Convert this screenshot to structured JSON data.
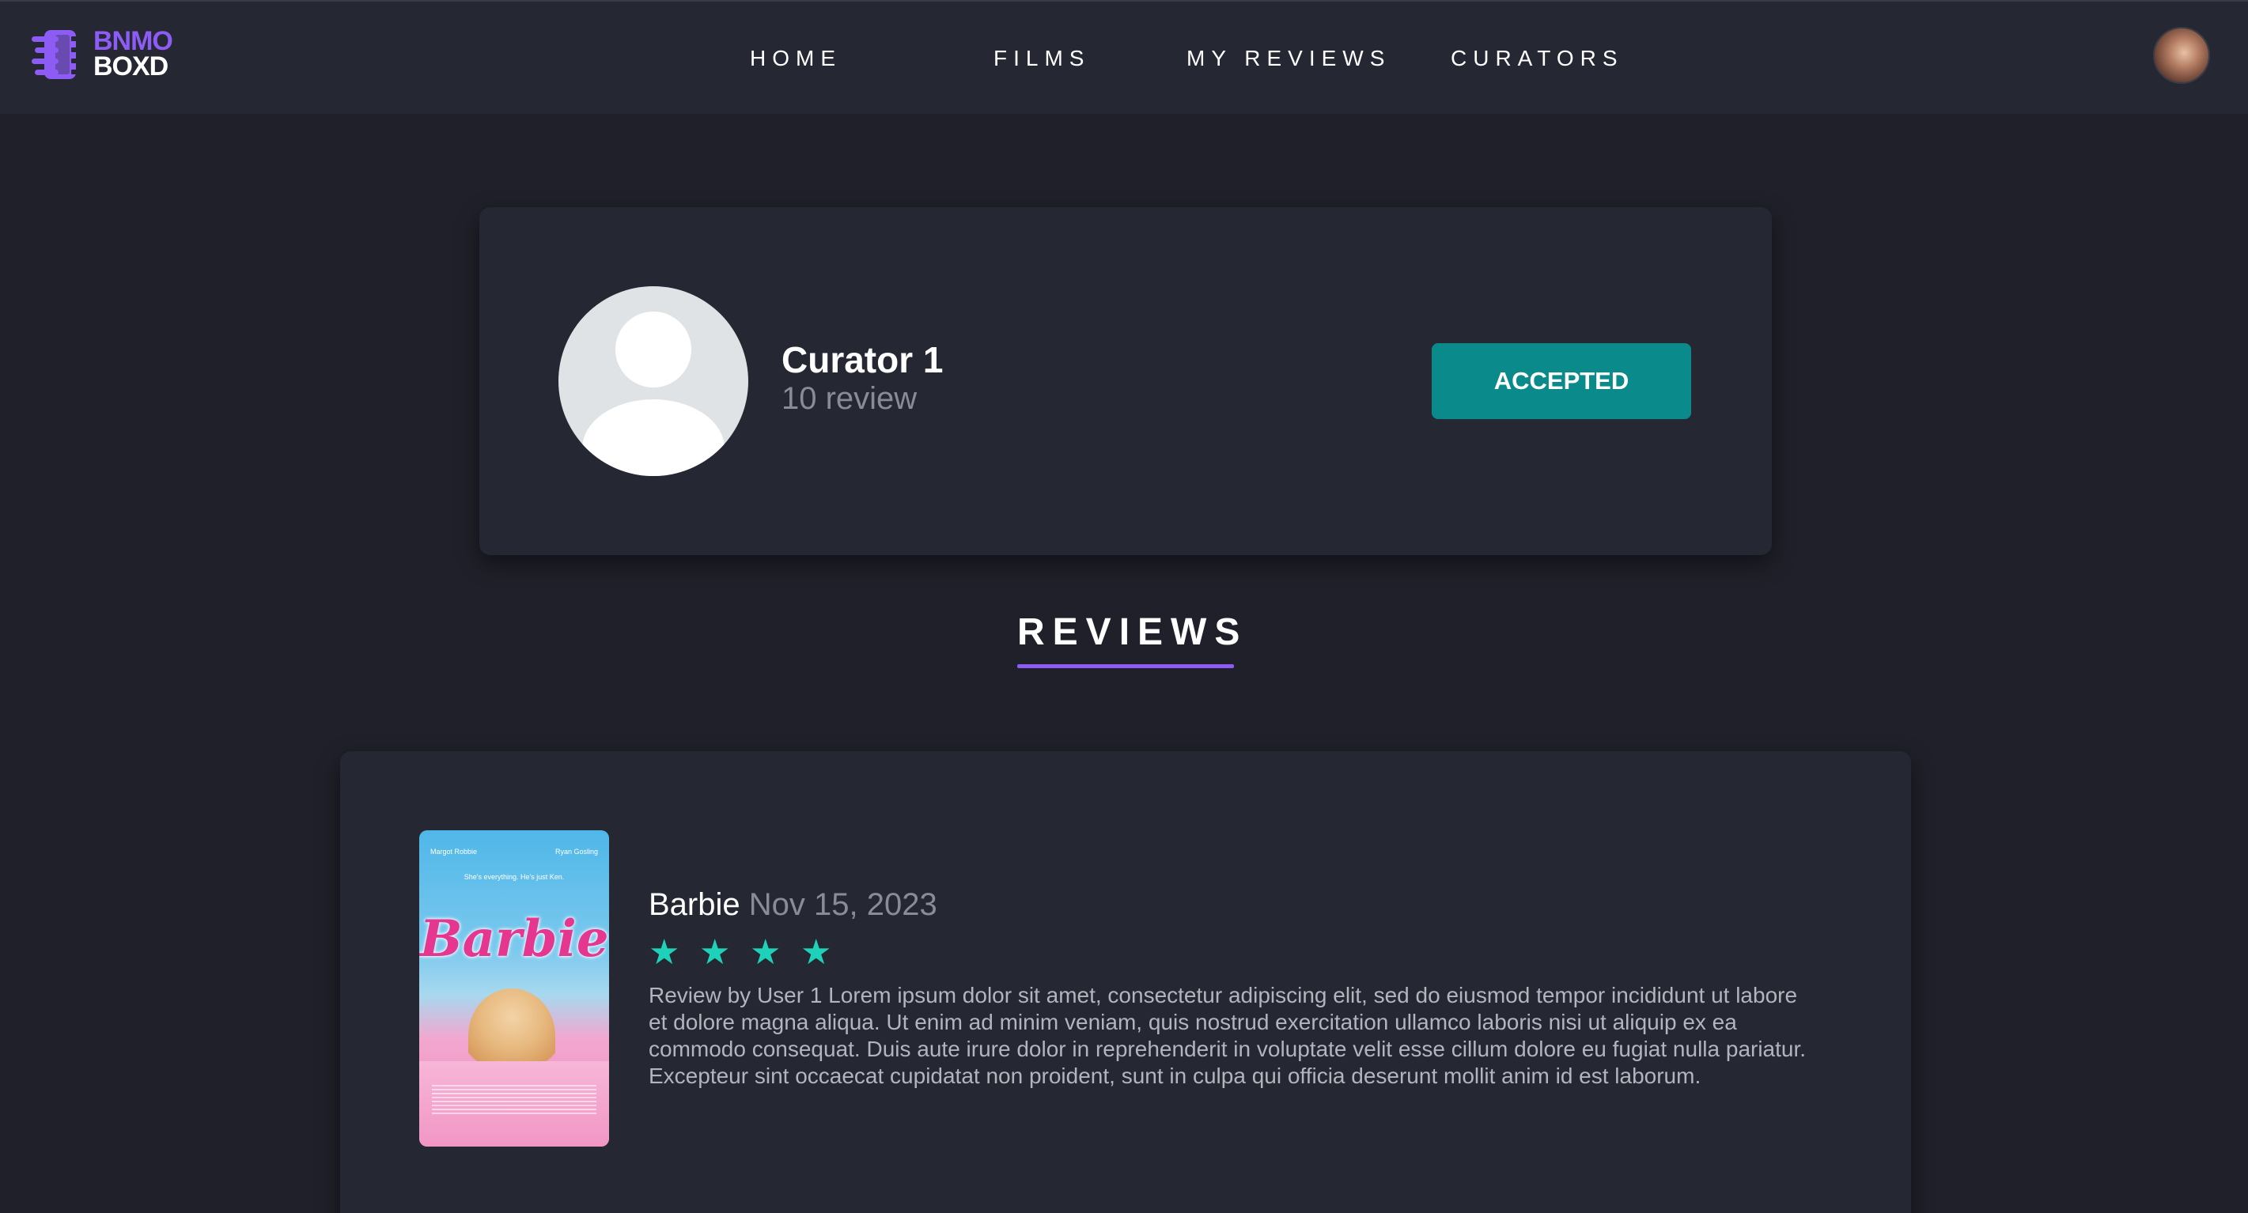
{
  "navbar": {
    "logo": {
      "line1": "BNMO",
      "line2": "BOXD"
    },
    "links": [
      {
        "label": "HOME"
      },
      {
        "label": "FILMS"
      },
      {
        "label": "MY REVIEWS"
      },
      {
        "label": "CURATORS"
      }
    ],
    "avatar_icon": "user-avatar"
  },
  "curator": {
    "name": "Curator 1",
    "review_count": "10 review",
    "status_label": "ACCEPTED",
    "profile_icon": "default-user-icon"
  },
  "reviews_section": {
    "title": "REVIEWS"
  },
  "reviews": [
    {
      "film": "Barbie",
      "date": "Nov 15, 2023",
      "rating": 4,
      "body": "Review by User 1 Lorem ipsum dolor sit amet, consectetur adipiscing elit, sed do eiusmod tempor incididunt ut labore et dolore magna aliqua. Ut enim ad minim veniam, quis nostrud exercitation ullamco laboris nisi ut aliquip ex ea commodo consequat. Duis aute irure dolor in reprehenderit in voluptate velit esse cillum dolore eu fugiat nulla pariatur. Excepteur sint occaecat cupidatat non proident, sunt in culpa qui officia deserunt mollit anim id est laborum.",
      "poster": {
        "title": "Barbie",
        "credit_left": "Margot Robbie",
        "credit_right": "Ryan Gosling",
        "tagline": "She's everything. He's just Ken."
      }
    }
  ],
  "colors": {
    "background": "#1f2029",
    "card": "#252733",
    "accent": "#8c5cf5",
    "status": "#0a8a8a",
    "star": "#1fd1b9",
    "muted": "#8a8b95"
  }
}
